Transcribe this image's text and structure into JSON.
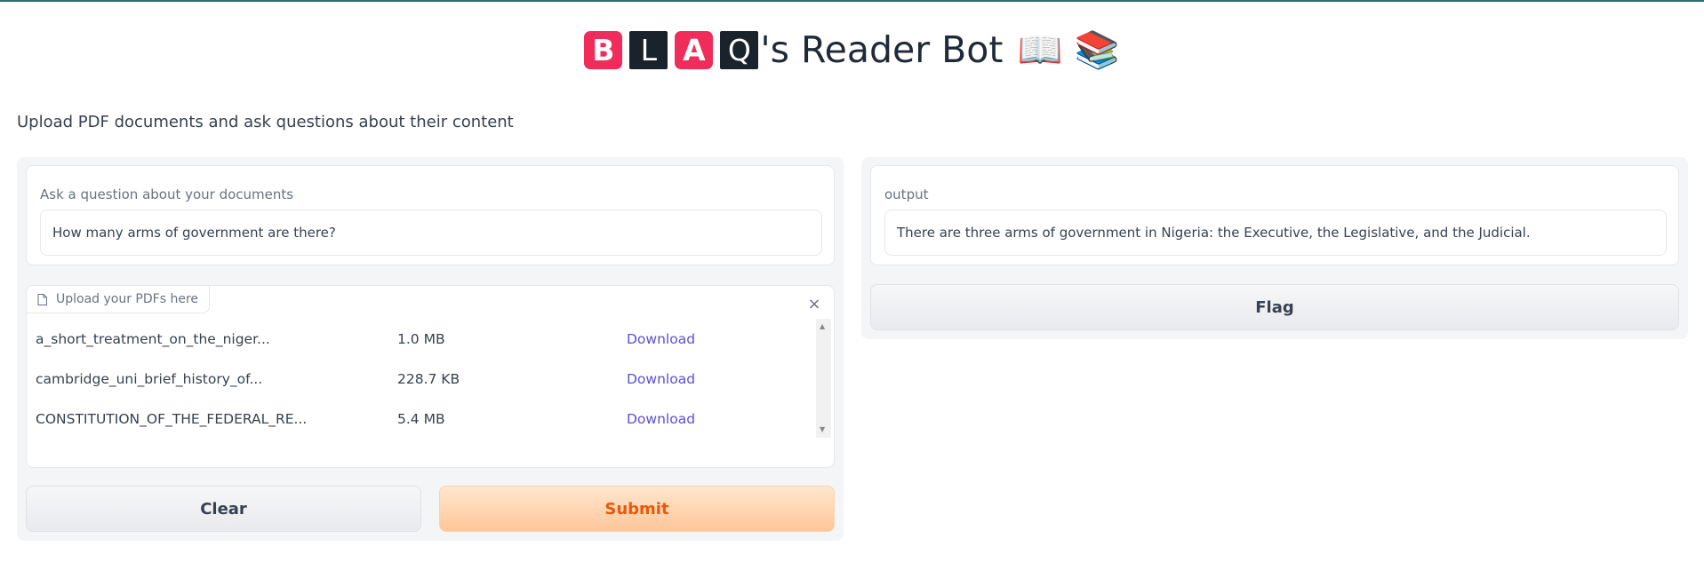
{
  "header": {
    "title_tiles": [
      "B",
      "L",
      "A",
      "Q"
    ],
    "title_suffix": "'s Reader Bot",
    "title_emojis": "📖 📚",
    "subtitle": "Upload PDF documents and ask questions about their content"
  },
  "question": {
    "label": "Ask a question about your documents",
    "value": "How many arms of government are there?"
  },
  "upload": {
    "tab_label": "Upload your PDFs here",
    "files": [
      {
        "name": "a_short_treatment_on_the_niger...",
        "size": "1.0 MB",
        "action": "Download"
      },
      {
        "name": "cambridge_uni_brief_history_of...",
        "size": "228.7 KB",
        "action": "Download"
      },
      {
        "name": "CONSTITUTION_OF_THE_FEDERAL_RE...",
        "size": "5.4 MB",
        "action": "Download"
      }
    ]
  },
  "buttons": {
    "clear": "Clear",
    "submit": "Submit",
    "flag": "Flag"
  },
  "output": {
    "label": "output",
    "value": "There are three arms of government in Nigeria: the Executive, the Legislative, and the Judicial."
  },
  "icons": {
    "file": "file-icon",
    "close": "close-icon",
    "scroll_up": "scroll-up-arrow-icon",
    "scroll_down": "scroll-down-arrow-icon"
  },
  "colors": {
    "tile_red": "#f02c5a",
    "tile_dark": "#1a222c",
    "submit_text": "#ea580c",
    "link": "#5b4fd6"
  }
}
